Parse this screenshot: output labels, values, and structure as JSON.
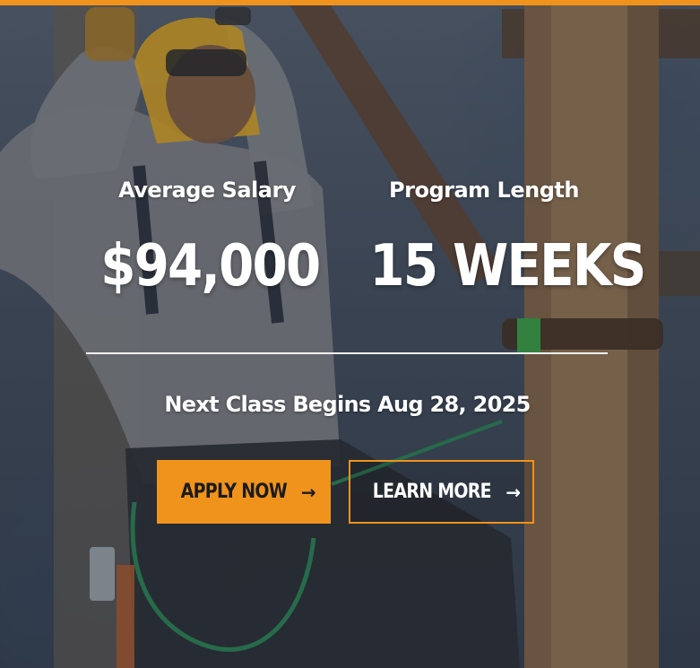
{
  "stats": {
    "salary": {
      "label": "Average Salary",
      "value": "$94,000"
    },
    "length": {
      "label": "Program Length",
      "value": "15 WEEKS"
    }
  },
  "next_class": "Next Class Begins Aug 28, 2025",
  "buttons": {
    "apply": {
      "label": "APPLY NOW",
      "arrow": "→"
    },
    "learn": {
      "label": "LEARN MORE",
      "arrow": "→"
    }
  },
  "colors": {
    "accent": "#f0931c",
    "text": "#ffffff",
    "button_text_dark": "#1b1b1b"
  },
  "icons": {
    "apply_arrow": "arrow-right-icon",
    "learn_arrow": "arrow-right-icon"
  }
}
